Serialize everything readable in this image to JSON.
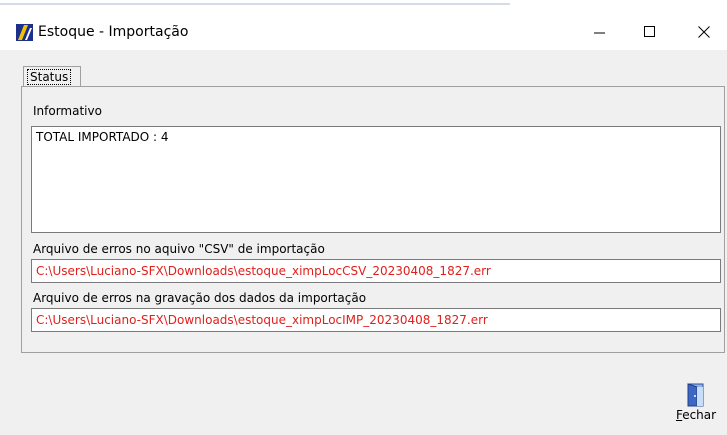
{
  "window": {
    "title": "Estoque - Importação",
    "icon": "app-logo-icon",
    "controls": [
      "minimize-icon",
      "maximize-icon",
      "close-icon"
    ]
  },
  "tabs": [
    {
      "label": "Status",
      "active": true
    }
  ],
  "panel": {
    "info_label": "Informativo",
    "info_text": "TOTAL IMPORTADO : 4",
    "csv_errors_label": "Arquivo de erros no aquivo \"CSV\" de importação",
    "csv_errors_path": "C:\\Users\\Luciano-SFX\\Downloads\\estoque_ximpLocCSV_20230408_1827.err",
    "save_errors_label": "Arquivo de erros na gravação dos dados da importação",
    "save_errors_path": "C:\\Users\\Luciano-SFX\\Downloads\\estoque_ximpLocIMP_20230408_1827.err"
  },
  "footer": {
    "close_button": {
      "label_first": "F",
      "label_rest": "echar",
      "icon": "exit-door-icon"
    }
  },
  "colors": {
    "error_text": "#e0201c",
    "window_bg": "#f0f0f0"
  }
}
